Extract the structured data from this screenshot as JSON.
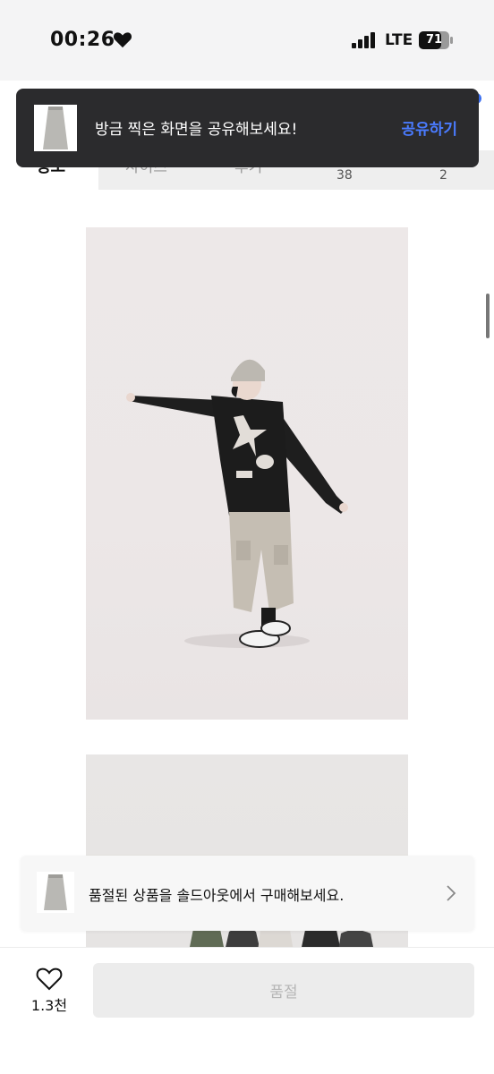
{
  "status_bar": {
    "time": "00:26",
    "network": "LTE",
    "battery": "71"
  },
  "background_header": {
    "tab_left": "정보",
    "tab_mid1": "사이즈",
    "tab_mid2": "후기",
    "num1": "38",
    "num2": "2"
  },
  "toast": {
    "message": "방금 찍은 화면을 공유해보세요!",
    "action_label": "공유하기"
  },
  "soldout_banner": {
    "message": "품절된 상품을 솔드아웃에서 구매해보세요."
  },
  "bottom_bar": {
    "like_count": "1.3천",
    "buy_label": "품절"
  },
  "colors": {
    "toast_bg": "#2b2b2d",
    "accent_blue": "#4a7bff",
    "disabled_button": "#ececec"
  }
}
